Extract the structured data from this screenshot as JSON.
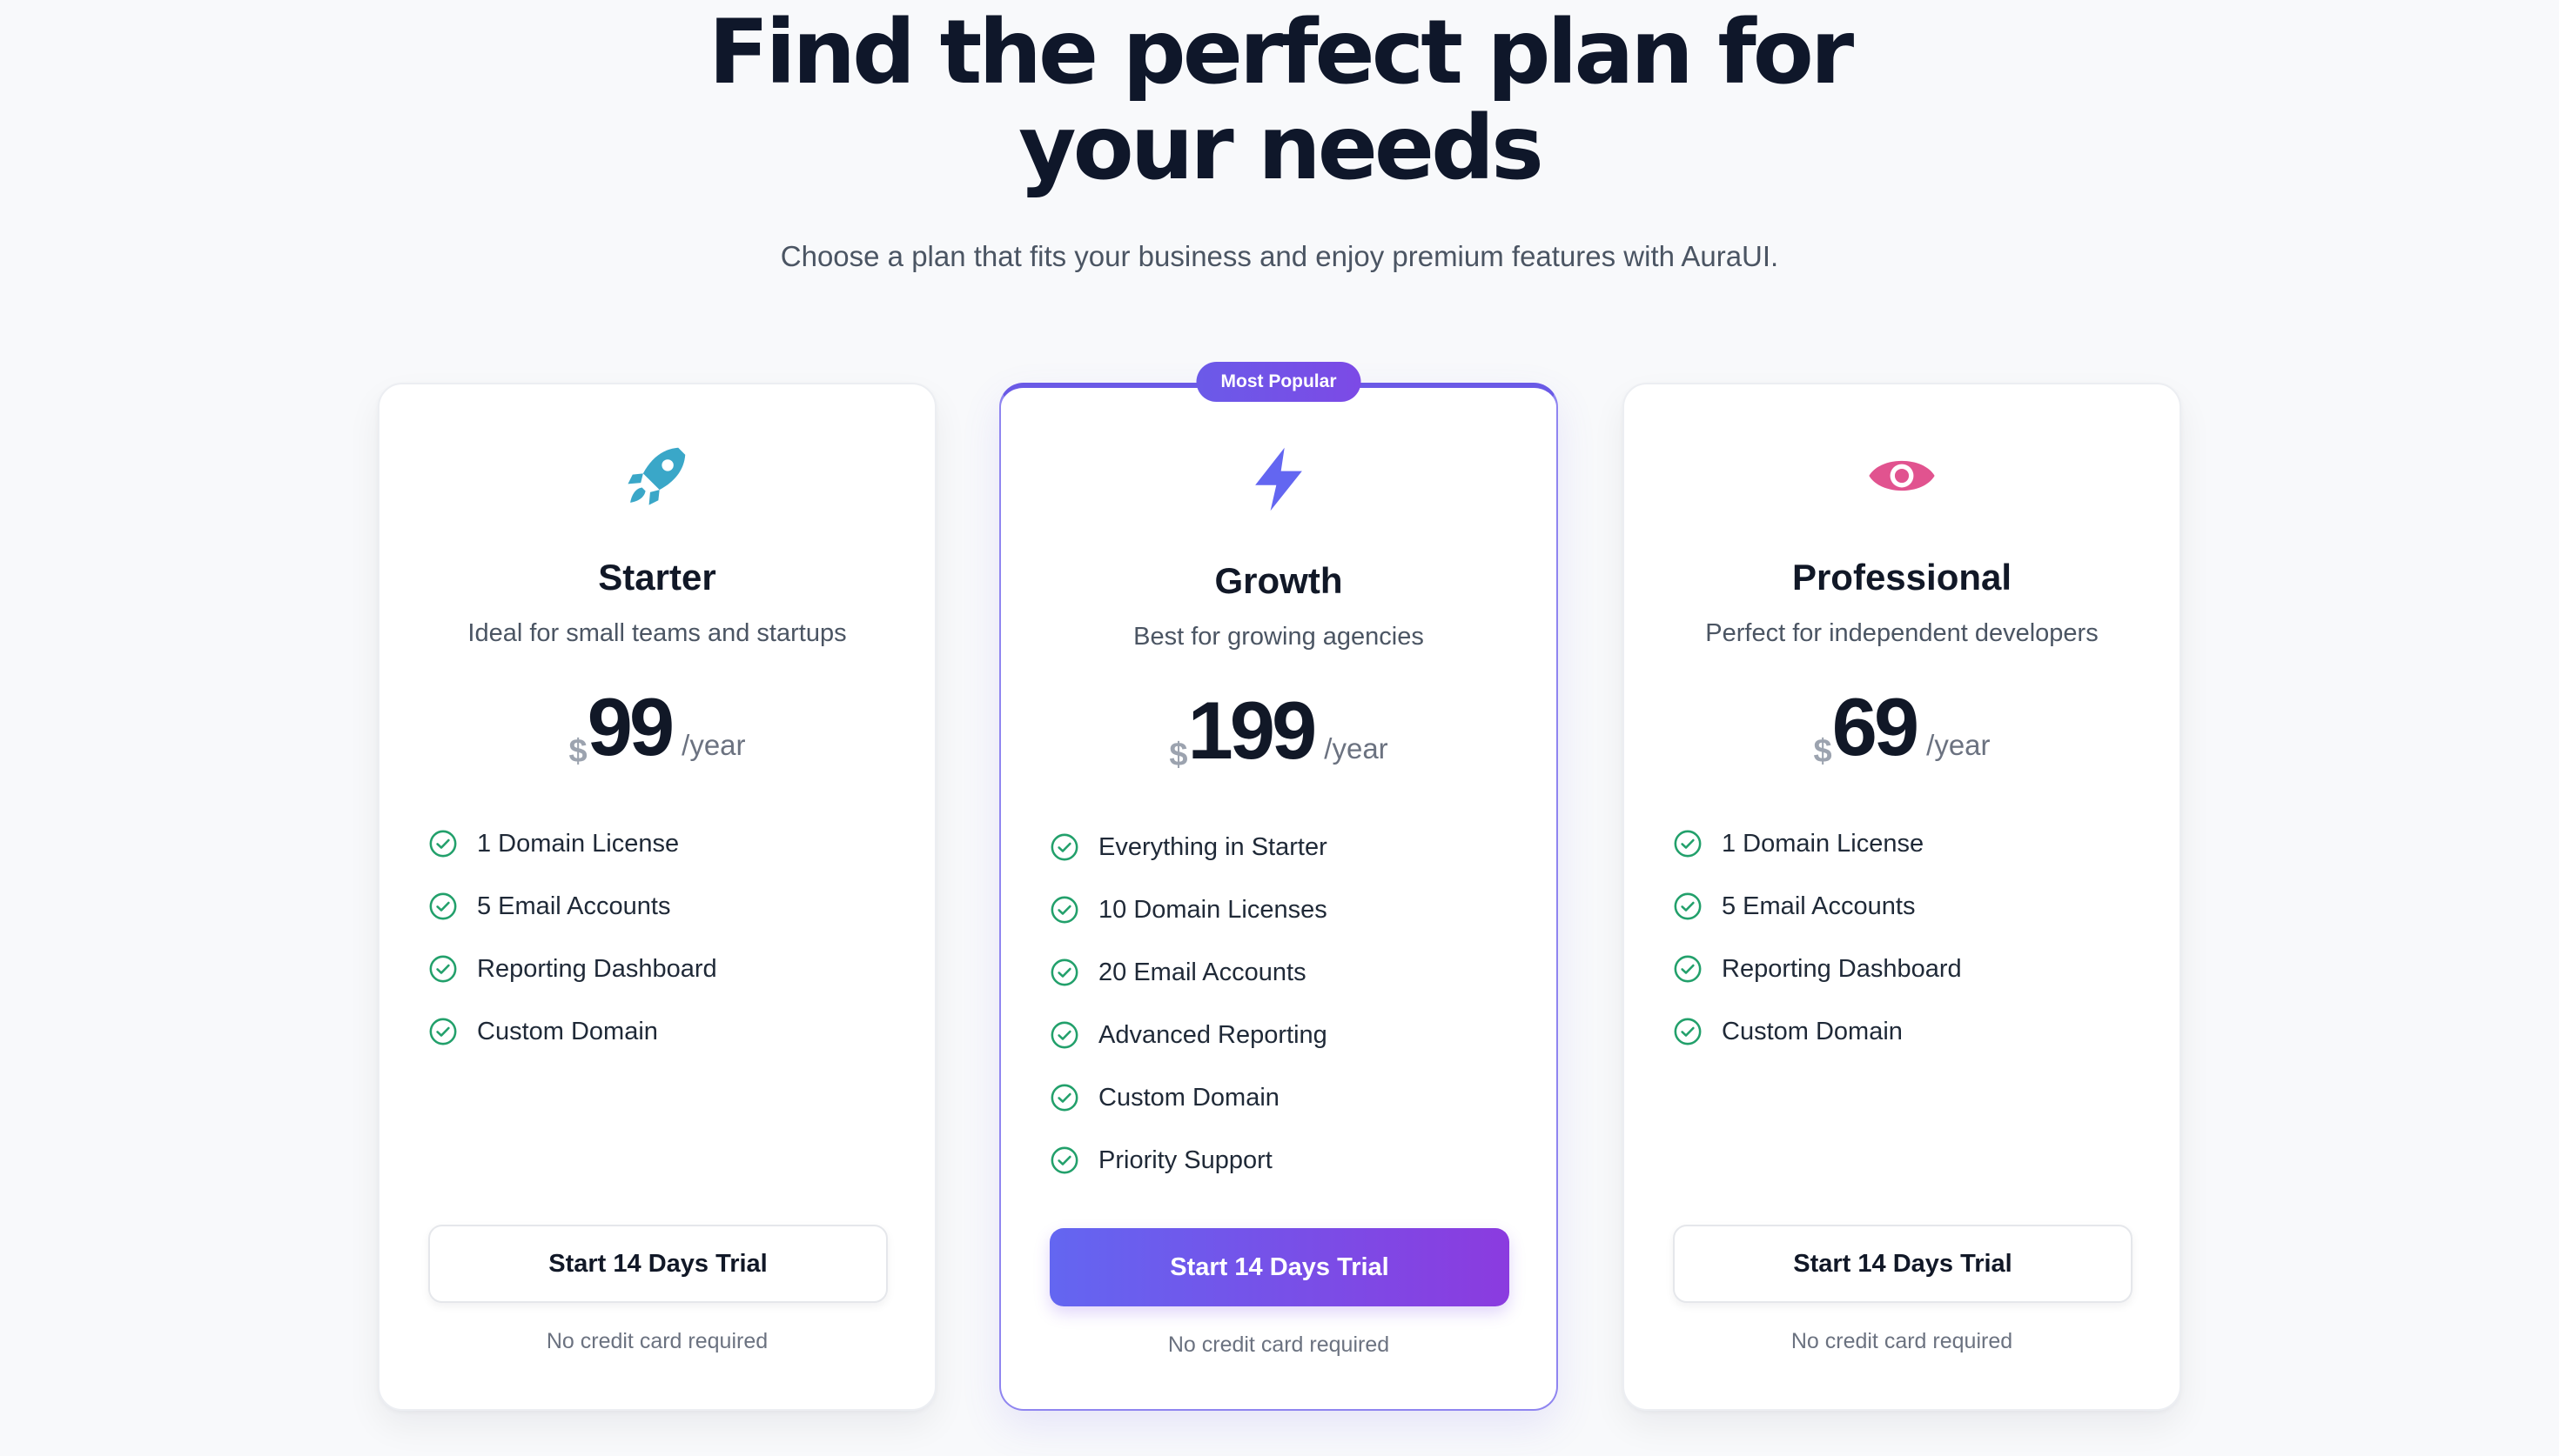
{
  "header": {
    "title_line1": "Find the perfect plan for",
    "title_line2": "your needs",
    "subtitle": "Choose a plan that fits your business and enjoy premium features with AuraUI."
  },
  "plans": [
    {
      "name": "Starter",
      "icon": "rocket-icon",
      "icon_color": "#3aa7c8",
      "description": "Ideal for small teams and startups",
      "currency": "$",
      "price": "99",
      "period": "/year",
      "features": [
        "1 Domain License",
        "5 Email Accounts",
        "Reporting Dashboard",
        "Custom Domain"
      ],
      "cta": "Start 14 Days Trial",
      "note": "No credit card required"
    },
    {
      "name": "Growth",
      "badge": "Most Popular",
      "icon": "lightning-icon",
      "icon_color": "#6366f1",
      "description": "Best for growing agencies",
      "currency": "$",
      "price": "199",
      "period": "/year",
      "features": [
        "Everything in Starter",
        "10 Domain Licenses",
        "20 Email Accounts",
        "Advanced Reporting",
        "Custom Domain",
        "Priority Support"
      ],
      "cta": "Start 14 Days Trial",
      "note": "No credit card required"
    },
    {
      "name": "Professional",
      "icon": "eye-icon",
      "icon_color": "#e1538f",
      "description": "Perfect for independent developers",
      "currency": "$",
      "price": "69",
      "period": "/year",
      "features": [
        "1 Domain License",
        "5 Email Accounts",
        "Reporting Dashboard",
        "Custom Domain"
      ],
      "cta": "Start 14 Days Trial",
      "note": "No credit card required"
    }
  ],
  "colors": {
    "check": "#22a06b",
    "accent_start": "#6366f1",
    "accent_end": "#8b3bdf"
  }
}
